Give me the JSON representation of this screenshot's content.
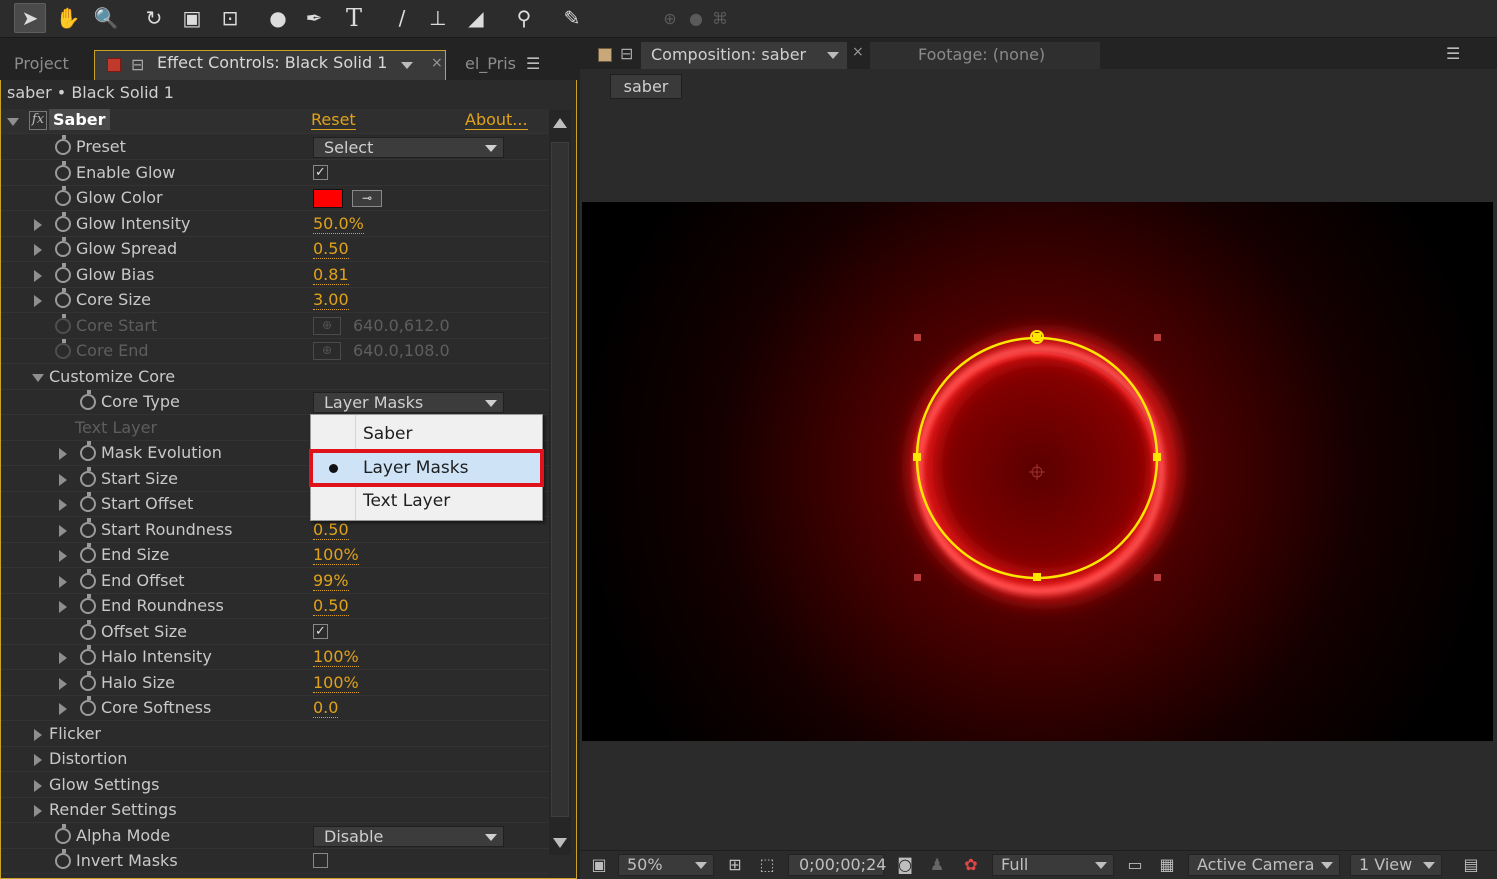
{
  "toolbar": {
    "tools": [
      {
        "icon": "selection-tool-icon",
        "glyph": "➤"
      },
      {
        "icon": "hand-tool-icon",
        "glyph": "✋"
      },
      {
        "icon": "zoom-tool-icon",
        "glyph": "🔍"
      },
      {
        "icon": "rotation-tool-icon",
        "glyph": "↻"
      },
      {
        "icon": "camera-orbit-tool-icon",
        "glyph": "▣"
      },
      {
        "icon": "pan-behind-tool-icon",
        "glyph": "⊡"
      },
      {
        "icon": "ellipse-tool-icon",
        "glyph": "●"
      },
      {
        "icon": "pen-tool-icon",
        "glyph": "✒"
      },
      {
        "icon": "type-tool-icon",
        "glyph": "T"
      },
      {
        "icon": "brush-tool-icon",
        "glyph": "/"
      },
      {
        "icon": "clone-stamp-tool-icon",
        "glyph": "⊥"
      },
      {
        "icon": "eraser-tool-icon",
        "glyph": "◢"
      },
      {
        "icon": "roto-brush-tool-icon",
        "glyph": "⚲"
      },
      {
        "icon": "puppet-pin-tool-icon",
        "glyph": "✎"
      }
    ]
  },
  "left_panel": {
    "tab_project": "Project",
    "tab_effect_controls": "Effect Controls: Black Solid 1",
    "tab_other": "el_Pris",
    "breadcrumb": "saber • Black Solid 1",
    "effect": {
      "name": "Saber",
      "reset": "Reset",
      "about": "About..."
    },
    "props": {
      "preset": {
        "label": "Preset",
        "value": "Select"
      },
      "enable_glow": {
        "label": "Enable Glow",
        "checked": true
      },
      "glow_color": {
        "label": "Glow Color",
        "color": "#ff0000"
      },
      "glow_intensity": {
        "label": "Glow Intensity",
        "value": "50.0%"
      },
      "glow_spread": {
        "label": "Glow Spread",
        "value": "0.50"
      },
      "glow_bias": {
        "label": "Glow Bias",
        "value": "0.81"
      },
      "core_size": {
        "label": "Core Size",
        "value": "3.00"
      },
      "core_start": {
        "label": "Core Start",
        "value": "640.0,612.0"
      },
      "core_end": {
        "label": "Core End",
        "value": "640.0,108.0"
      },
      "customize_core": {
        "label": "Customize Core"
      },
      "core_type": {
        "label": "Core Type",
        "value": "Layer Masks"
      },
      "text_layer": {
        "label": "Text Layer"
      },
      "mask_evolution": {
        "label": "Mask Evolution"
      },
      "start_size": {
        "label": "Start Size"
      },
      "start_offset": {
        "label": "Start Offset"
      },
      "start_roundness": {
        "label": "Start Roundness",
        "value": "0.50"
      },
      "end_size": {
        "label": "End Size",
        "value": "100%"
      },
      "end_offset": {
        "label": "End Offset",
        "value": "99%"
      },
      "end_roundness": {
        "label": "End Roundness",
        "value": "0.50"
      },
      "offset_size": {
        "label": "Offset Size",
        "checked": true
      },
      "halo_intensity": {
        "label": "Halo Intensity",
        "value": "100%"
      },
      "halo_size": {
        "label": "Halo Size",
        "value": "100%"
      },
      "core_softness": {
        "label": "Core Softness",
        "value": "0.0"
      },
      "flicker": {
        "label": "Flicker"
      },
      "distortion": {
        "label": "Distortion"
      },
      "glow_settings": {
        "label": "Glow Settings"
      },
      "render_settings": {
        "label": "Render Settings"
      },
      "alpha_mode": {
        "label": "Alpha Mode",
        "value": "Disable"
      },
      "invert_masks": {
        "label": "Invert Masks",
        "checked": false
      }
    },
    "core_type_menu": {
      "options": [
        "Saber",
        "Layer Masks",
        "Text Layer"
      ],
      "selected": "Layer Masks"
    }
  },
  "right_panel": {
    "tab_composition": "Composition: saber",
    "tab_footage": "Footage: (none)",
    "comp_chip": "saber",
    "viewer": {
      "glow_color": "#ff1a1a",
      "ring_color": "#ffe600"
    },
    "bottom": {
      "zoom": "50%",
      "timecode": "0;00;00;24",
      "resolution": "Full",
      "camera": "Active Camera",
      "views": "1 View"
    }
  }
}
